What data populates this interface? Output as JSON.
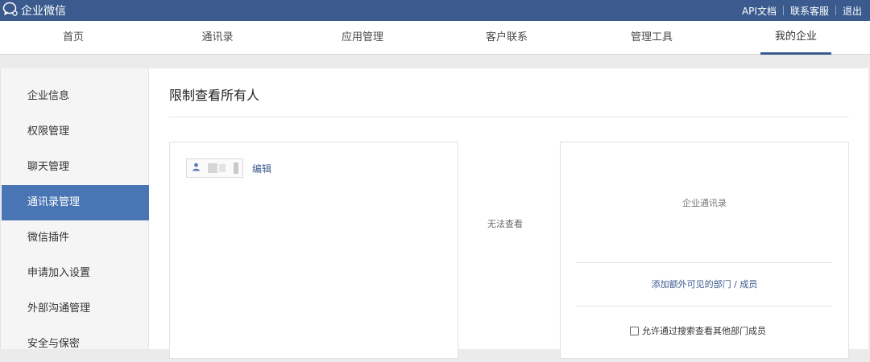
{
  "topbar": {
    "logo_text": "企业微信",
    "links": [
      "API文档",
      "联系客服",
      "退出"
    ]
  },
  "nav": {
    "items": [
      "首页",
      "通讯录",
      "应用管理",
      "客户联系",
      "管理工具",
      "我的企业"
    ],
    "active": "我的企业"
  },
  "sidebar": {
    "items": [
      "企业信息",
      "权限管理",
      "聊天管理",
      "通讯录管理",
      "微信插件",
      "申请加入设置",
      "外部沟通管理",
      "安全与保密"
    ],
    "active": "通讯录管理"
  },
  "main": {
    "title": "限制查看所有人",
    "edit_label": "编辑",
    "middle_note": "无法查看",
    "org_label": "企业通讯录",
    "add_link": "添加额外可见的部门 / 成员",
    "checkbox_label": "允许通过搜索查看其他部门成员"
  },
  "colors": {
    "brand": "#3b5b8e",
    "sidebar_active": "#4a75b5"
  }
}
